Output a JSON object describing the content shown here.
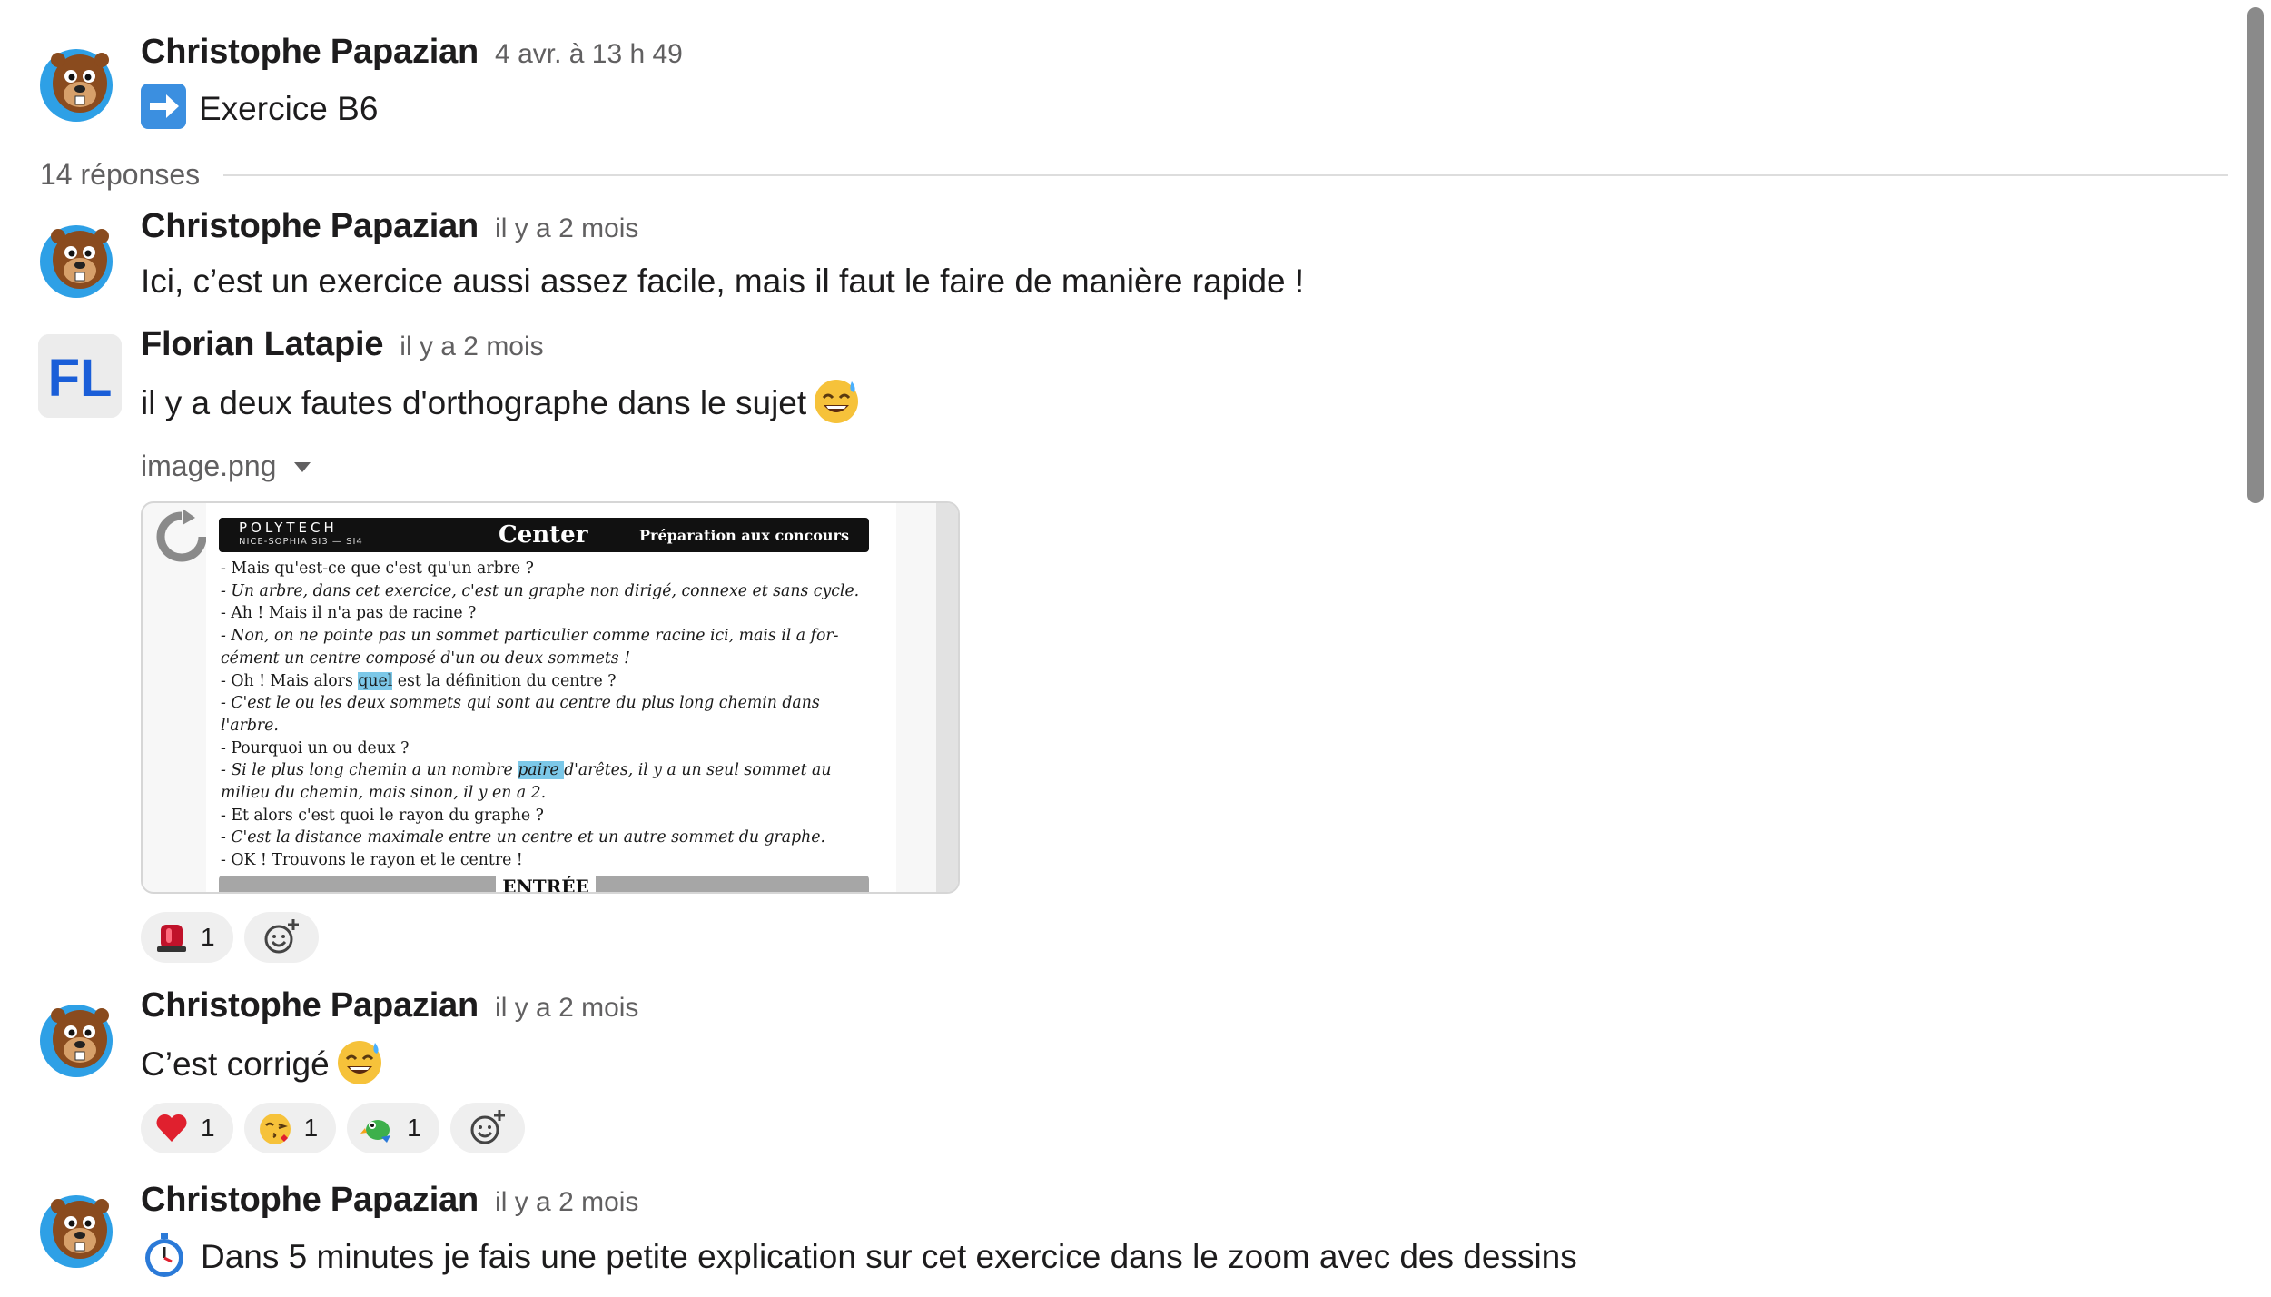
{
  "thread": {
    "root": {
      "author": "Christophe Papazian",
      "time": "4 avr. à 13 h 49",
      "text": "Exercice B6",
      "icon": "right-arrow-emoji-icon"
    },
    "replies_label": "14 réponses",
    "messages": [
      {
        "author": "Christophe Papazian",
        "time": "il y a 2 mois",
        "text": "Ici, c’est un exercice aussi assez facile, mais il faut le faire de manière rapide !"
      },
      {
        "author": "Florian Latapie",
        "avatar_initials": "FL",
        "time": "il y a 2 mois",
        "text": "il y a deux fautes d'orthographe dans le sujet",
        "emoji": "sweat-smile-emoji-icon",
        "attachment": {
          "file_name": "image.png",
          "doc": {
            "brand": "POLYTECH",
            "brand_sub": "NICE-SOPHIA   SI3 — SI4",
            "center": "Center",
            "prep": "Préparation aux concours",
            "lines": [
              {
                "t": "- Mais qu'est-ce que c'est qu'un arbre ?",
                "it": false
              },
              {
                "t": "- Un arbre, dans cet exercice, c'est un graphe non dirigé, connexe et sans cycle.",
                "it": true
              },
              {
                "t": "- Ah ! Mais il n'a pas de racine ?",
                "it": false
              },
              {
                "t": "- Non, on ne pointe pas un sommet particulier comme racine ici, mais il a for-",
                "it": true
              },
              {
                "t": "cément un centre composé d'un ou deux sommets !",
                "it": true
              },
              {
                "pre": "- Oh ! Mais alors ",
                "hl": "quel",
                "post": " est la définition du centre ?",
                "it": false
              },
              {
                "t": "- C'est le ou les deux sommets qui sont au centre du plus long chemin dans",
                "it": true
              },
              {
                "t": "l'arbre.",
                "it": true
              },
              {
                "t": "- Pourquoi un ou deux ?",
                "it": false
              },
              {
                "pre": "- Si le plus long chemin a un nombre ",
                "hl": "paire ",
                "post": "d'arêtes, il y a un seul sommet au",
                "it": true
              },
              {
                "t": "milieu du chemin, mais sinon, il y en a 2.",
                "it": true
              },
              {
                "t": "- Et alors c'est quoi le rayon du graphe ?",
                "it": false
              },
              {
                "t": "- C'est la distance maximale entre un centre et un autre sommet du graphe.",
                "it": true
              },
              {
                "t": "- OK ! Trouvons le rayon et le centre !",
                "it": false
              }
            ],
            "footer": "ENTRÉE"
          }
        },
        "reactions": [
          {
            "icon": "red-siren-icon",
            "count": "1"
          }
        ]
      },
      {
        "author": "Christophe Papazian",
        "time": "il y a 2 mois",
        "text": "C’est corrigé",
        "emoji": "sweat-smile-emoji-icon",
        "reactions": [
          {
            "icon": "red-heart-icon",
            "count": "1"
          },
          {
            "icon": "kissing-face-icon",
            "count": "1"
          },
          {
            "icon": "parrot-icon",
            "count": "1"
          }
        ]
      },
      {
        "author": "Christophe Papazian",
        "time": "il y a 2 mois",
        "text": "Dans 5 minutes je fais une petite explication sur cet exercice dans le zoom avec des dessins",
        "icon": "stopwatch-emoji-icon"
      }
    ]
  },
  "colors": {
    "author": "#1d1c1d",
    "muted": "#616061",
    "reaction_bg": "#efefef",
    "fl_avatar": "#1a5ed8"
  }
}
